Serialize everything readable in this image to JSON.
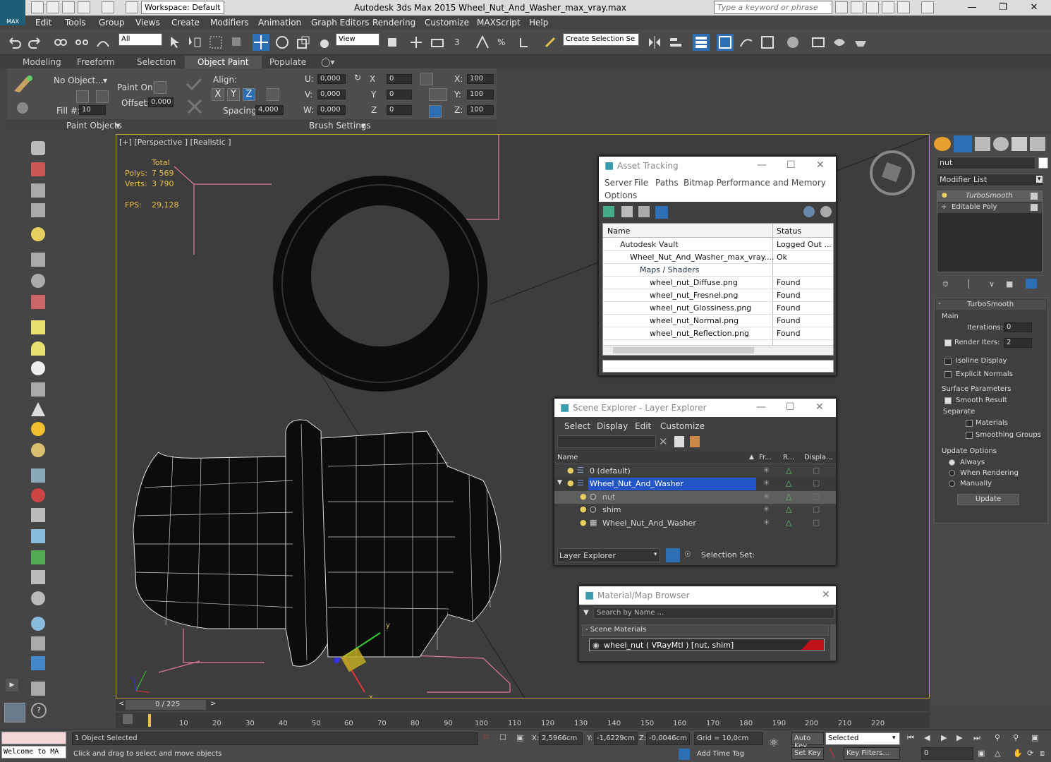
{
  "app": {
    "title": "Autodesk 3ds Max  2015     Wheel_Nut_And_Washer_max_vray.max",
    "workspace": "Workspace: Default",
    "search_placeholder": "Type a keyword or phrase",
    "logo": "MAX"
  },
  "menu": [
    "Edit",
    "Tools",
    "Group",
    "Views",
    "Create",
    "Modifiers",
    "Animation",
    "Graph Editors",
    "Rendering",
    "Customize",
    "MAXScript",
    "Help"
  ],
  "toolbar": {
    "filter": "All",
    "ref_coord": "View",
    "selection_set": "Create Selection Se"
  },
  "ribbon": {
    "tabs": [
      "Modeling",
      "Freeform",
      "Selection",
      "Object Paint",
      "Populate"
    ],
    "active_tab": "Object Paint",
    "no_object": "No Object...",
    "paint_on": "Paint On:",
    "offset_label": "Offset:",
    "offset_value": "0,000",
    "fill_label": "Fill #:",
    "fill_value": "10",
    "align_label": "Align:",
    "axes": [
      "X",
      "Y",
      "Z"
    ],
    "spacing_label": "Spacing:",
    "spacing_value": "4,000",
    "u_label": "U:",
    "u_value": "0,000",
    "v_label": "V:",
    "v_value": "0,000",
    "w_label": "W:",
    "w_value": "0,000",
    "rx_label": "X",
    "rx_value": "0",
    "ry_label": "Y",
    "ry_value": "0",
    "rz_label": "Z",
    "rz_value": "0",
    "sx_label": "X:",
    "sx_value": "100",
    "sy_label": "Y:",
    "sy_value": "100",
    "sz_label": "Z:",
    "sz_value": "100",
    "group_paint": "Paint Objects",
    "group_brush": "Brush Settings"
  },
  "viewport": {
    "label": "[+] [Perspective ] [Realistic ]",
    "total_label": "Total",
    "polys_label": "Polys:",
    "polys_value": "7 569",
    "verts_label": "Verts:",
    "verts_value": "3 790",
    "fps_label": "FPS:",
    "fps_value": "29,128",
    "gizmo_x": "x",
    "gizmo_y": "y"
  },
  "asset_tracking": {
    "title": "Asset Tracking",
    "menu": [
      "Server",
      "File",
      "Paths",
      "Bitmap Performance and Memory",
      "Options"
    ],
    "col_name": "Name",
    "col_status": "Status",
    "rows": [
      {
        "name": "Autodesk Vault",
        "status": "Logged Out ..."
      },
      {
        "name": "Wheel_Nut_And_Washer_max_vray....",
        "status": "Ok"
      },
      {
        "name": "Maps / Shaders",
        "status": ""
      },
      {
        "name": "wheel_nut_Diffuse.png",
        "status": "Found"
      },
      {
        "name": "wheel_nut_Fresnel.png",
        "status": "Found"
      },
      {
        "name": "wheel_nut_Glossiness.png",
        "status": "Found"
      },
      {
        "name": "wheel_nut_Normal.png",
        "status": "Found"
      },
      {
        "name": "wheel_nut_Reflection.png",
        "status": "Found"
      }
    ]
  },
  "scene_explorer": {
    "title": "Scene Explorer - Layer Explorer",
    "menu": [
      "Select",
      "Display",
      "Edit",
      "Customize"
    ],
    "col_name": "Name",
    "col_fr": "Fr...",
    "col_r": "R...",
    "col_disp": "Displa...",
    "rows": [
      {
        "name": "0 (default)"
      },
      {
        "name": "Wheel_Nut_And_Washer"
      },
      {
        "name": "nut"
      },
      {
        "name": "shim"
      },
      {
        "name": "Wheel_Nut_And_Washer"
      }
    ],
    "footer_mode": "Layer Explorer",
    "selection_set": "Selection Set:"
  },
  "material_browser": {
    "title": "Material/Map Browser",
    "search_placeholder": "Search by Name ...",
    "group": "- Scene Materials",
    "item": "wheel_nut  ( VRayMtl ) [nut, shim]",
    "accent": "#c0101a"
  },
  "command_panel": {
    "name_value": "nut",
    "modifier_list": "Modifier List",
    "stack": [
      "TurboSmooth",
      "Editable Poly"
    ],
    "rollout_title": "TurboSmooth",
    "main_label": "Main",
    "iterations_label": "Iterations:",
    "iterations_value": "0",
    "render_iters_label": "Render Iters:",
    "render_iters_value": "2",
    "isoline": "Isoline Display",
    "explicit": "Explicit Normals",
    "surface_params": "Surface Parameters",
    "smooth_result": "Smooth Result",
    "separate": "Separate",
    "materials": "Materials",
    "smoothing_groups": "Smoothing Groups",
    "update_options": "Update Options",
    "always": "Always",
    "when_rendering": "When Rendering",
    "manually": "Manually",
    "update_btn": "Update"
  },
  "timeline": {
    "frame": "0 / 225",
    "ticks": [
      "10",
      "20",
      "30",
      "40",
      "50",
      "60",
      "70",
      "80",
      "90",
      "100",
      "110",
      "120",
      "130",
      "140",
      "150",
      "160",
      "170",
      "180",
      "190",
      "200",
      "210",
      "220"
    ]
  },
  "status": {
    "maxscript": "Welcome to MA",
    "selected": "1 Object Selected",
    "prompt": "Click and drag to select and move objects",
    "x_label": "X:",
    "x_value": "2,5966cm",
    "y_label": "Y:",
    "y_value": "-1,6229cm",
    "z_label": "Z:",
    "z_value": "-0,0046cm",
    "grid": "Grid = 10,0cm",
    "add_time_tag": "Add Time Tag",
    "auto_key": "Auto Key",
    "set_key": "Set Key",
    "selected_dropdown": "Selected",
    "key_filters": "Key Filters...",
    "frame_value": "0"
  }
}
